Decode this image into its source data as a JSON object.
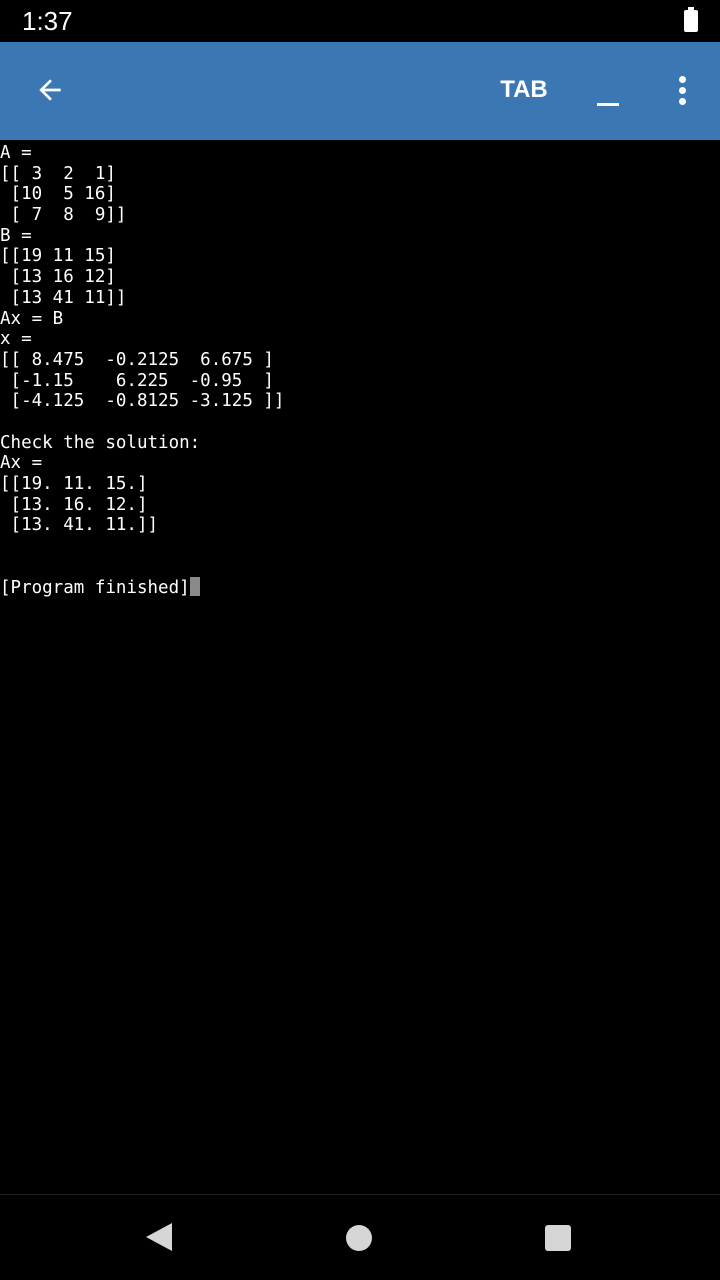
{
  "status_bar": {
    "time": "1:37",
    "battery_icon": "battery-icon"
  },
  "toolbar": {
    "background": "#3b78b3",
    "back_icon": "arrow-back-icon",
    "tab_label": "TAB",
    "underscore_icon": "underscore-key-icon",
    "overflow_icon": "more-vert-icon"
  },
  "terminal": {
    "lines": [
      "A =",
      "[[ 3  2  1]",
      " [10  5 16]",
      " [ 7  8  9]]",
      "B =",
      "[[19 11 15]",
      " [13 16 12]",
      " [13 41 11]]",
      "Ax = B",
      "x =",
      "[[ 8.475  -0.2125  6.675 ]",
      " [-1.15    6.225  -0.95  ]",
      " [-4.125  -0.8125 -3.125 ]]",
      "",
      "Check the solution:",
      "Ax =",
      "[[19. 11. 15.]",
      " [13. 16. 12.]",
      " [13. 41. 11.]]",
      "",
      "",
      "[Program finished]"
    ]
  },
  "nav_bar": {
    "back_icon": "nav-back-icon",
    "home_icon": "nav-home-icon",
    "recents_icon": "nav-recents-icon"
  }
}
